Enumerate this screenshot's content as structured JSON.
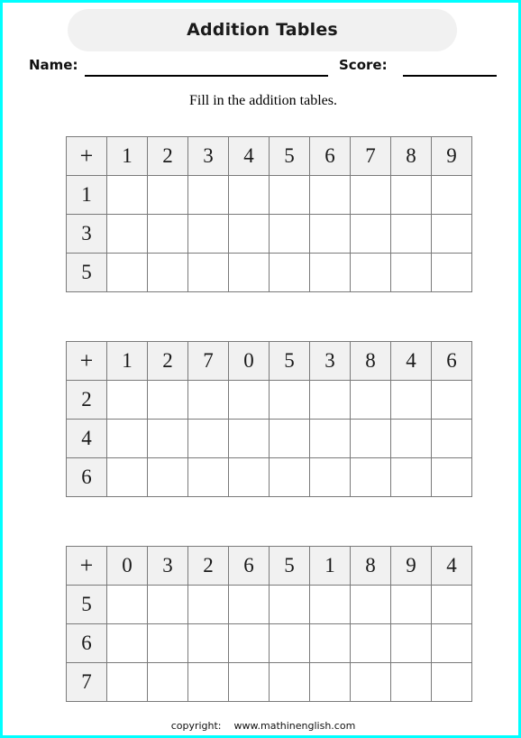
{
  "page": {
    "border_color": "#00ffff",
    "background_color": "#ffffff"
  },
  "header": {
    "title": "Addition Tables",
    "pill_color": "#f1f1f1",
    "name_label": "Name:",
    "score_label": "Score:"
  },
  "instruction": "Fill in the addition tables.",
  "tables": [
    {
      "corner": "+",
      "columns": [
        "1",
        "2",
        "3",
        "4",
        "5",
        "6",
        "7",
        "8",
        "9"
      ],
      "rows": [
        "1",
        "3",
        "5"
      ]
    },
    {
      "corner": "+",
      "columns": [
        "1",
        "2",
        "7",
        "0",
        "5",
        "3",
        "8",
        "4",
        "6"
      ],
      "rows": [
        "2",
        "4",
        "6"
      ]
    },
    {
      "corner": "+",
      "columns": [
        "0",
        "3",
        "2",
        "6",
        "5",
        "1",
        "8",
        "9",
        "4"
      ],
      "rows": [
        "5",
        "6",
        "7"
      ]
    }
  ],
  "footer": {
    "copyright_label": "copyright:",
    "site": "www.mathinenglish.com"
  }
}
